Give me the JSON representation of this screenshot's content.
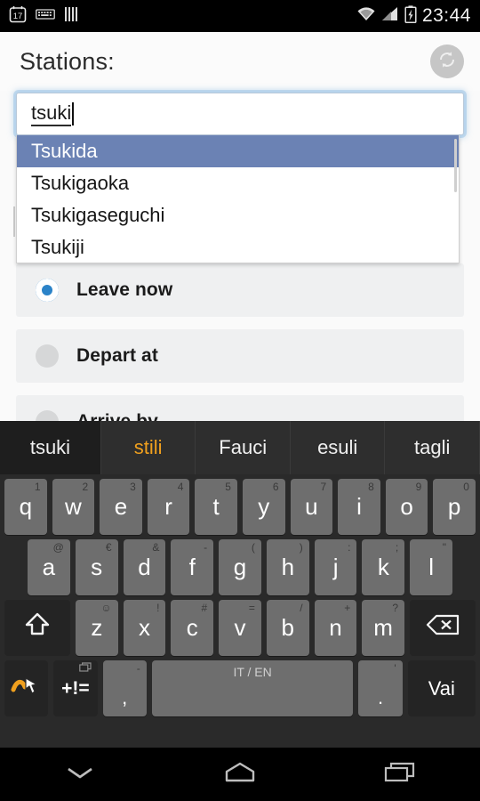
{
  "status_bar": {
    "left_icons": [
      {
        "name": "calendar-icon",
        "label": "17"
      },
      {
        "name": "keyboard-icon",
        "label": ""
      },
      {
        "name": "barcode-icon",
        "label": ""
      }
    ],
    "right_icons": [
      {
        "name": "wifi-icon",
        "label": ""
      },
      {
        "name": "cellular-signal-icon",
        "label": ""
      },
      {
        "name": "battery-charging-icon",
        "label": ""
      }
    ],
    "time": "23:44"
  },
  "app_bar": {
    "title": "Stations:",
    "swap_icon": "swap-refresh-icon"
  },
  "search": {
    "value": "tsuki",
    "placeholder": "",
    "suggestions": [
      {
        "label": "Tsukida",
        "selected": true
      },
      {
        "label": "Tsukigaoka",
        "selected": false
      },
      {
        "label": "Tsukigaseguchi",
        "selected": false
      },
      {
        "label": "Tsukiji",
        "selected": false
      }
    ]
  },
  "time_options": [
    {
      "label": "Leave now",
      "selected": true
    },
    {
      "label": "Depart at",
      "selected": false
    },
    {
      "label": "Arrive by",
      "selected": false
    }
  ],
  "keyboard": {
    "suggestion_bar": [
      {
        "label": "tsuki",
        "state": "active"
      },
      {
        "label": "stili",
        "state": "hint"
      },
      {
        "label": "Fauci",
        "state": "normal"
      },
      {
        "label": "esuli",
        "state": "normal"
      },
      {
        "label": "tagli",
        "state": "normal"
      }
    ],
    "row1": [
      {
        "key": "q",
        "sup": "1"
      },
      {
        "key": "w",
        "sup": "2"
      },
      {
        "key": "e",
        "sup": "3"
      },
      {
        "key": "r",
        "sup": "4"
      },
      {
        "key": "t",
        "sup": "5"
      },
      {
        "key": "y",
        "sup": "6"
      },
      {
        "key": "u",
        "sup": "7"
      },
      {
        "key": "i",
        "sup": "8"
      },
      {
        "key": "o",
        "sup": "9"
      },
      {
        "key": "p",
        "sup": "0"
      }
    ],
    "row2": [
      {
        "key": "a",
        "sup": "@"
      },
      {
        "key": "s",
        "sup": "€"
      },
      {
        "key": "d",
        "sup": "&"
      },
      {
        "key": "f",
        "sup": "-"
      },
      {
        "key": "g",
        "sup": "("
      },
      {
        "key": "h",
        "sup": ")"
      },
      {
        "key": "j",
        "sup": ":"
      },
      {
        "key": "k",
        "sup": ";"
      },
      {
        "key": "l",
        "sup": "\""
      }
    ],
    "row3": [
      {
        "key": "z",
        "sup": "☺"
      },
      {
        "key": "x",
        "sup": "!"
      },
      {
        "key": "c",
        "sup": "#"
      },
      {
        "key": "v",
        "sup": "="
      },
      {
        "key": "b",
        "sup": "/"
      },
      {
        "key": "n",
        "sup": "+"
      },
      {
        "key": "m",
        "sup": "?"
      }
    ],
    "shift_icon": "shift-up-arrow-icon",
    "backspace_icon": "backspace-delete-icon",
    "gesture_icon": "swipe-gesture-icon",
    "symbols_key": "+!=",
    "symbols_sup_icon": "window-switch-icon",
    "comma_key": ",",
    "comma_sup": "-",
    "space_key": "IT / EN",
    "period_key": ".",
    "period_sup": "'",
    "go_key": "Vai"
  },
  "nav_bar": [
    {
      "name": "hide-keyboard-icon",
      "label": ""
    },
    {
      "name": "home-icon",
      "label": ""
    },
    {
      "name": "recent-apps-icon",
      "label": ""
    }
  ],
  "colors": {
    "accent_radio": "#2b83c8",
    "dropdown_select": "#6b82b4",
    "suggestion_hint": "#f0a01e",
    "status_bar_bg": "#000000"
  }
}
